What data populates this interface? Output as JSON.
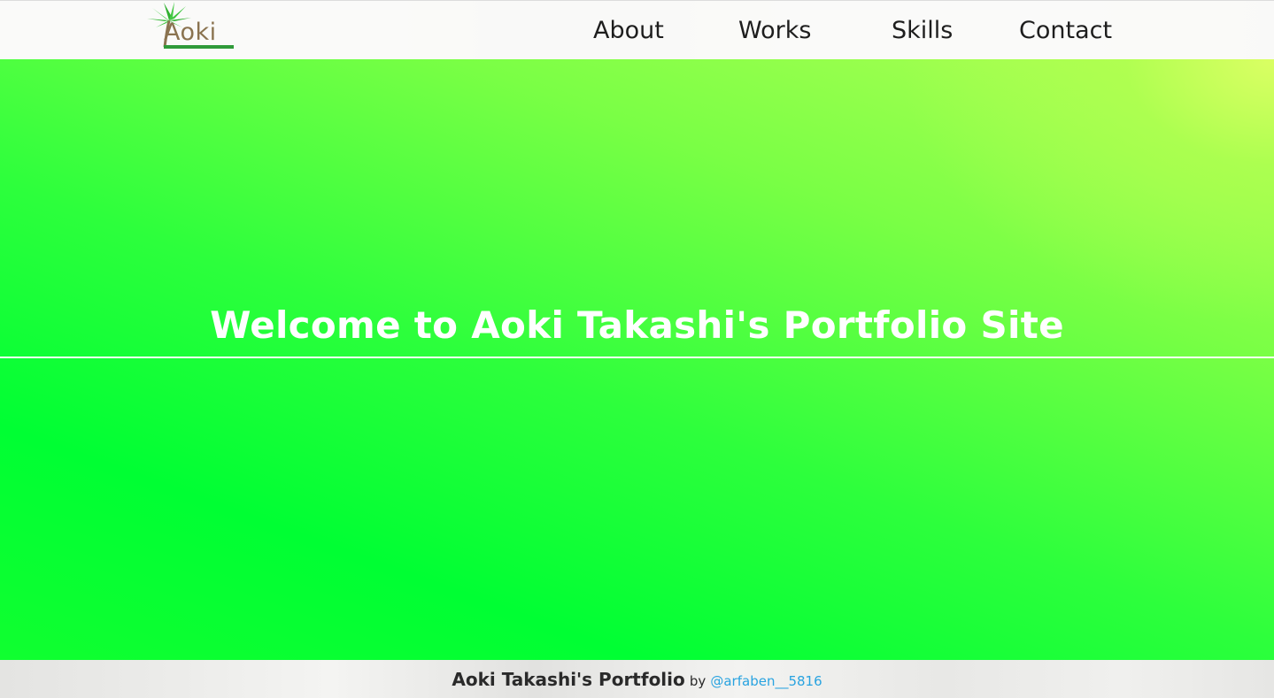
{
  "header": {
    "logo": {
      "word": "Aoki",
      "icon": "palm-tree-icon",
      "leaf_color": "#3cc63c",
      "trunk_color": "#8a7350",
      "bar_color": "#2f9a3a"
    },
    "nav": {
      "about": "About",
      "works": "Works",
      "skills": "Skills",
      "contact": "Contact"
    }
  },
  "hero": {
    "title": "Welcome to Aoki Takashi's Portfolio Site",
    "colors": {
      "main": "#00ff33",
      "corner": "#d8ff66"
    }
  },
  "footer": {
    "title": "Aoki Takashi's Portfolio",
    "by": "by",
    "handle": "@arfaben__5816",
    "handle_color": "#29a3e0"
  }
}
